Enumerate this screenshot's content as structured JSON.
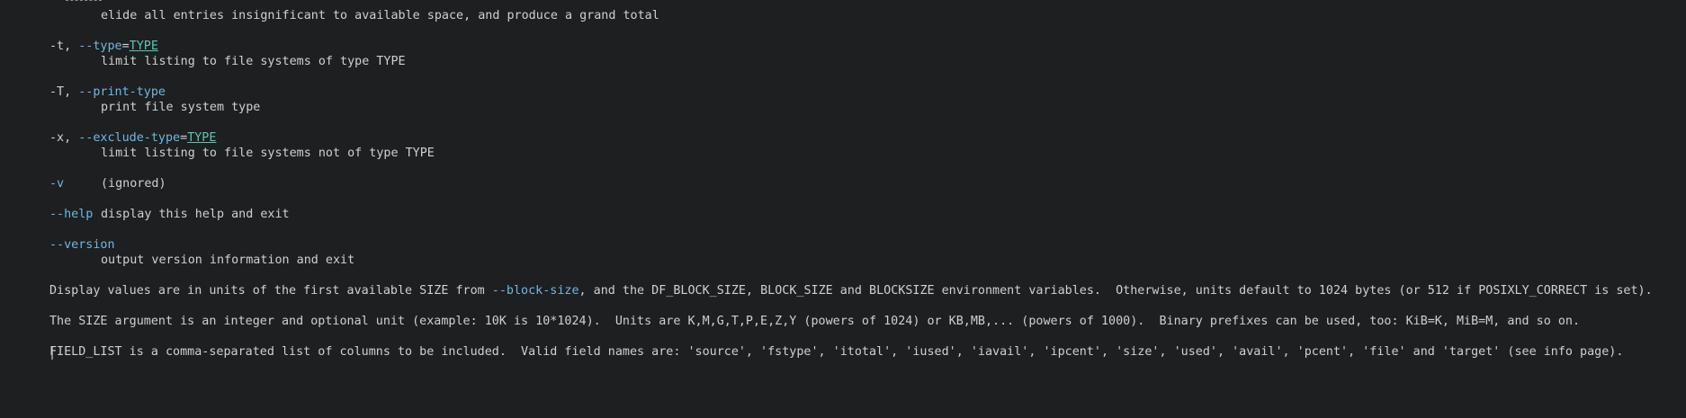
{
  "grand_total_desc": "elide all entries insignificant to available space, and produce a grand total",
  "options": {
    "type": {
      "short": "-t,",
      "long": "--type",
      "eq": "=",
      "arg": "TYPE",
      "desc": "limit listing to file systems of type TYPE"
    },
    "print_type": {
      "short": "-T,",
      "long": "--print-type",
      "desc": "print file system type"
    },
    "exclude_type": {
      "short": "-x,",
      "long": "--exclude-type",
      "eq": "=",
      "arg": "TYPE",
      "desc": "limit listing to file systems not of type TYPE"
    },
    "v": {
      "short": "-v",
      "desc": "(ignored)"
    },
    "help": {
      "long": "--help",
      "desc": "display this help and exit"
    },
    "version": {
      "long": "--version",
      "desc": "output version information and exit"
    }
  },
  "paragraphs": {
    "display_values_a": "Display values are in units of the first available SIZE from ",
    "display_values_opt": "--block-size",
    "display_values_b": ", and the DF_BLOCK_SIZE, BLOCK_SIZE and BLOCKSIZE environment variables.  Otherwise, units default to 1024 bytes (or 512 if POSIXLY_CORRECT is set).",
    "size_argument": "The SIZE argument is an integer and optional unit (example: 10K is 10*1024).  Units are K,M,G,T,P,E,Z,Y (powers of 1024) or KB,MB,... (powers of 1000).  Binary prefixes can be used, too: KiB=K, MiB=M, and so on.",
    "field_list": "FIELD_LIST is a comma-separated list of columns to be included.  Valid field names are: 'source', 'fstype', 'itotal', 'iused', 'iavail', 'ipcent', 'size', 'used', 'avail', 'pcent', 'file' and 'target' (see info page)."
  },
  "colors": {
    "background": "#1d1f21",
    "text": "#cfd1cf",
    "option": "#6fb8e0",
    "argument": "#5cc6b4"
  }
}
